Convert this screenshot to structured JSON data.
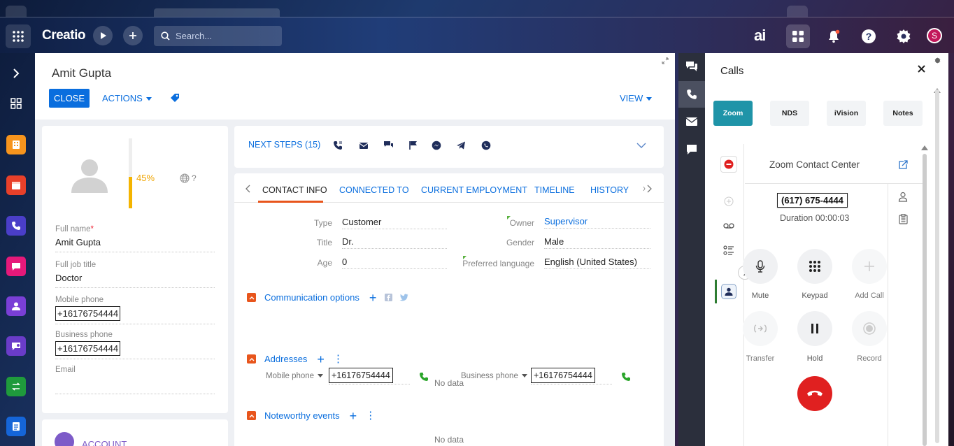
{
  "header": {
    "logo": "Creatio",
    "search_placeholder": "Search...",
    "ai_label": "ai",
    "avatar_letter": "S"
  },
  "record": {
    "name": "Amit Gupta",
    "close_label": "CLOSE",
    "actions_label": "ACTIONS",
    "view_label": "VIEW"
  },
  "profile": {
    "completeness": "45%",
    "completeness_value": 45,
    "timezone_suffix": "?",
    "fields": [
      {
        "label": "Full name",
        "value": "Amit Gupta",
        "required": "*"
      },
      {
        "label": "Full job title",
        "value": "Doctor"
      },
      {
        "label": "Mobile phone",
        "value": "+16176754444"
      },
      {
        "label": "Business phone",
        "value": "+16176754444"
      },
      {
        "label": "Email",
        "value": ""
      }
    ],
    "account_label": "ACCOUNT"
  },
  "next_steps": {
    "label": "NEXT STEPS (15)"
  },
  "tabs": [
    "CONTACT INFO",
    "CONNECTED TO",
    "CURRENT EMPLOYMENT",
    "TIMELINE",
    "HISTORY"
  ],
  "contact_info": {
    "type": {
      "label": "Type",
      "value": "Customer"
    },
    "title": {
      "label": "Title",
      "value": "Dr."
    },
    "age": {
      "label": "Age",
      "value": "0"
    },
    "owner": {
      "label": "Owner",
      "value": "Supervisor"
    },
    "gender": {
      "label": "Gender",
      "value": "Male"
    },
    "language": {
      "label": "Preferred language",
      "value": "English (United States)"
    }
  },
  "sections": {
    "communication": {
      "title": "Communication options",
      "mobile_label": "Mobile phone",
      "mobile_value": "+16176754444",
      "business_label": "Business phone",
      "business_value": "+16176754444"
    },
    "addresses": {
      "title": "Addresses",
      "no_data": "No data"
    },
    "noteworthy": {
      "title": "Noteworthy events",
      "no_data": "No data"
    }
  },
  "calls": {
    "title": "Calls",
    "providers": [
      "Zoom",
      "NDS",
      "iVision",
      "Notes"
    ],
    "zoom_title": "Zoom Contact Center",
    "phone": "(617) 675-4444",
    "duration": "Duration 00:00:03",
    "buttons": {
      "mute": "Mute",
      "keypad": "Keypad",
      "add_call": "Add Call",
      "transfer": "Transfer",
      "hold": "Hold",
      "record": "Record"
    }
  },
  "colors": {
    "accent": "#0a6ede",
    "orange": "#e8551c",
    "zoom_teal": "#1f94a8",
    "hangup": "#e02020",
    "progress": "#f4b400"
  }
}
